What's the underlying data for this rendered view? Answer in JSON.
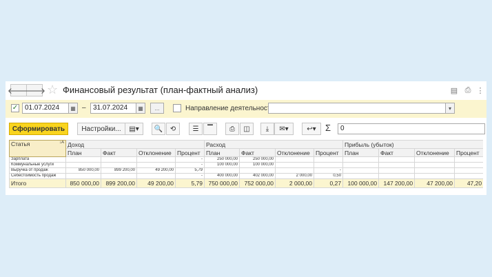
{
  "window": {
    "title": "Финансовый результат (план-фактный анализ)",
    "nav_back_icon": "arrow-left-icon",
    "nav_forward_icon": "arrow-right-icon",
    "back_glyph": "🡐",
    "forward_glyph": "🡒",
    "star_glyph": "☆",
    "save_glyph": "▤",
    "print_glyph": "⎙",
    "more_glyph": "⋮"
  },
  "params": {
    "date_from": "01.07.2024",
    "dash": "–",
    "date_to": "31.07.2024",
    "ellipsis": "...",
    "direction_label": "Направление деятельности:",
    "direction_value": "",
    "check_glyph": "✓",
    "calendar_glyph": "▦",
    "dropdown_glyph": "▾"
  },
  "toolbar": {
    "form_label": "Сформировать",
    "settings_label": "Настройки...",
    "sum_glyph": "Σ",
    "sum_value": "0",
    "variant_glyph": "▤",
    "search_glyph": "🔍",
    "search_replace_glyph": "⟲",
    "tree_glyph": "☰",
    "header_glyph": "▔",
    "print_glyph": "⎙",
    "preview_glyph": "◫",
    "export_glyph": "⤓",
    "mail_glyph": "✉",
    "undo_glyph": "↩",
    "arrow_glyph": "▾"
  },
  "table": {
    "article_header": "Статья",
    "sort_glyph": "↓A",
    "groups": [
      "Доход",
      "Расход",
      "Прибыль (убыток)"
    ],
    "subheaders": [
      "План",
      "Факт",
      "Отклонение",
      "Процент"
    ],
    "rows": [
      {
        "name": "Зарплата",
        "cells": [
          "",
          "",
          "",
          "-",
          "250 000,00",
          "250 000,00",
          "",
          "",
          "",
          "",
          "",
          ""
        ]
      },
      {
        "name": "Коммунальные услуги",
        "cells": [
          "",
          "",
          "",
          "-",
          "100 000,00",
          "100 000,00",
          "",
          "",
          "",
          "",
          "",
          ""
        ]
      },
      {
        "name": "Выручка от продаж",
        "cells": [
          "850 000,00",
          "899 200,00",
          "49 200,00",
          "5,79",
          "",
          "",
          "",
          "-",
          "",
          "",
          "",
          ""
        ]
      },
      {
        "name": "Себестоимость продаж",
        "cells": [
          "",
          "",
          "",
          "-",
          "400 000,00",
          "402 000,00",
          "2 000,00",
          "0,50",
          "",
          "",
          "",
          ""
        ]
      }
    ],
    "total": {
      "name": "Итого",
      "cells": [
        "850 000,00",
        "899 200,00",
        "49 200,00",
        "5,79",
        "750 000,00",
        "752 000,00",
        "2 000,00",
        "0,27",
        "100 000,00",
        "147 200,00",
        "47 200,00",
        "47,20"
      ]
    }
  }
}
